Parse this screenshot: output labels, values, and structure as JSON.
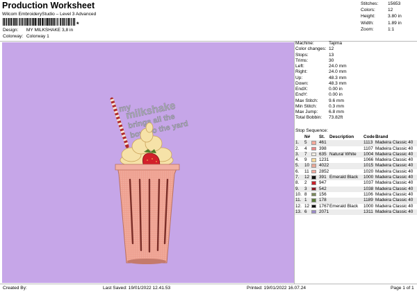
{
  "header": {
    "title": "Production Worksheet",
    "subtitle": "Wilcom EmbroideryStudio – Level 3 Advanced",
    "barcode_text": "*",
    "design_label": "Design:",
    "design_value": "MY MILKSHAKE 3,8 in",
    "colorway_label": "Colorway:",
    "colorway_value": "Colorway 1"
  },
  "summary": [
    {
      "k": "Stitches:",
      "v": "15653"
    },
    {
      "k": "Colors:",
      "v": "12"
    },
    {
      "k": "Height:",
      "v": "3.80 in"
    },
    {
      "k": "Width:",
      "v": "1.89 in"
    },
    {
      "k": "Zoom:",
      "v": "1:1"
    }
  ],
  "design_text": {
    "line1": "my",
    "line2": "milkshake",
    "line3": "brings all the",
    "line4": "boys to the yard"
  },
  "machine_info": [
    {
      "k": "Machine:",
      "v": "Tajima"
    },
    {
      "k": "Color changes:",
      "v": "12"
    },
    {
      "k": "Stops:",
      "v": "13"
    },
    {
      "k": "Trims:",
      "v": "30"
    },
    {
      "k": "Left:",
      "v": "24.0 mm"
    },
    {
      "k": "Right:",
      "v": "24.0 mm"
    },
    {
      "k": "Up:",
      "v": "48.3 mm"
    },
    {
      "k": "Down:",
      "v": "48.3 mm"
    },
    {
      "k": "EndX:",
      "v": "0.00 in"
    },
    {
      "k": "EndY:",
      "v": "0.00 in"
    },
    {
      "k": "Max Stitch:",
      "v": "9.6 mm"
    },
    {
      "k": "Min Stitch:",
      "v": "0.3 mm"
    },
    {
      "k": "Max Jump:",
      "v": "6.8 mm"
    },
    {
      "k": "Total Bobbin:",
      "v": "73.82ft"
    }
  ],
  "stop_sequence": {
    "title": "Stop Sequence:",
    "headers": {
      "n": "N#",
      "st": "St.",
      "desc": "Description",
      "code": "Code",
      "brand": "Brand"
    },
    "rows": [
      {
        "stop": "1.",
        "n": "5",
        "color": "#f4a89a",
        "st": "461",
        "desc": "",
        "code": "1113",
        "brand": "Madeira Classic 40"
      },
      {
        "stop": "2.",
        "n": "4",
        "color": "#ec8888",
        "st": "398",
        "desc": "",
        "code": "1107",
        "brand": "Madeira Classic 40"
      },
      {
        "stop": "3.",
        "n": "7",
        "color": "#f3efe4",
        "st": "635",
        "desc": "Natural White",
        "code": "1004",
        "brand": "Madeira Classic 40"
      },
      {
        "stop": "4.",
        "n": "9",
        "color": "#f6d89a",
        "st": "1231",
        "desc": "",
        "code": "1066",
        "brand": "Madeira Classic 40"
      },
      {
        "stop": "5.",
        "n": "10",
        "color": "#e8a898",
        "st": "4022",
        "desc": "",
        "code": "1015",
        "brand": "Madeira Classic 40"
      },
      {
        "stop": "6.",
        "n": "11",
        "color": "#f2a89e",
        "st": "2852",
        "desc": "",
        "code": "1020",
        "brand": "Madeira Classic 40"
      },
      {
        "stop": "7.",
        "n": "12",
        "color": "#111111",
        "st": "391",
        "desc": "Emerald Black",
        "code": "1000",
        "brand": "Madeira Classic 40"
      },
      {
        "stop": "8.",
        "n": "2",
        "color": "#c8202a",
        "st": "947",
        "desc": "",
        "code": "1037",
        "brand": "Madeira Classic 40"
      },
      {
        "stop": "9.",
        "n": "3",
        "color": "#8a1a24",
        "st": "542",
        "desc": "",
        "code": "1038",
        "brand": "Madeira Classic 40"
      },
      {
        "stop": "10.",
        "n": "8",
        "color": "#7a8a5a",
        "st": "156",
        "desc": "",
        "code": "1106",
        "brand": "Madeira Classic 40"
      },
      {
        "stop": "11.",
        "n": "1",
        "color": "#5a7a3a",
        "st": "178",
        "desc": "",
        "code": "1189",
        "brand": "Madeira Classic 40"
      },
      {
        "stop": "12.",
        "n": "12",
        "color": "#111111",
        "st": "1767",
        "desc": "Emerald Black",
        "code": "1000",
        "brand": "Madeira Classic 40"
      },
      {
        "stop": "13.",
        "n": "6",
        "color": "#9a8ac8",
        "st": "2071",
        "desc": "",
        "code": "1311",
        "brand": "Madeira Classic 40"
      }
    ]
  },
  "footer": {
    "created_by": "Created By:",
    "last_saved": "Last Saved: 19/01/2022 12.41.53",
    "printed": "Printed: 19/01/2022 16.07.24",
    "page": "Page 1 of 1"
  },
  "colors": {
    "canvas": "#c6a6e8",
    "text_fill": "#a8a8b4"
  }
}
